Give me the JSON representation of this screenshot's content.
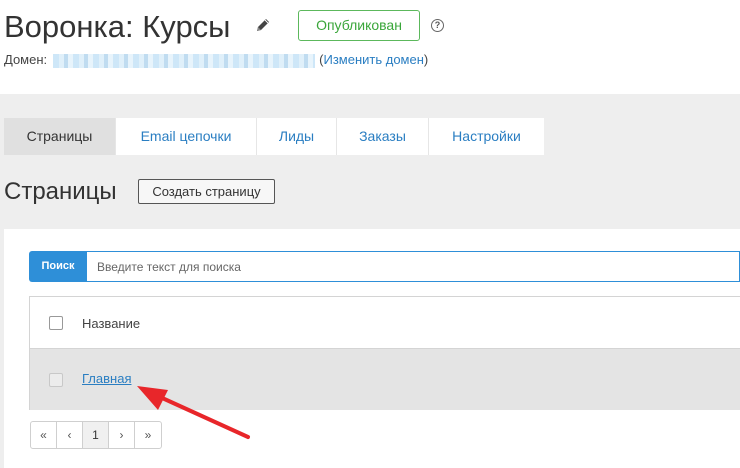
{
  "header": {
    "title": "Воронка: Курсы",
    "publish_button": "Опубликован",
    "help_icon": "?",
    "domain_label": "Домен:",
    "domain_paren_open": "(",
    "change_domain_link": "Изменить домен",
    "domain_paren_close": ")"
  },
  "tabs": [
    {
      "label": "Страницы",
      "active": true
    },
    {
      "label": "Email цепочки",
      "active": false
    },
    {
      "label": "Лиды",
      "active": false
    },
    {
      "label": "Заказы",
      "active": false
    },
    {
      "label": "Настройки",
      "active": false
    }
  ],
  "section": {
    "title": "Страницы",
    "create_button": "Создать страницу"
  },
  "search": {
    "button": "Поиск",
    "placeholder": "Введите текст для поиска"
  },
  "table": {
    "column_name": "Название",
    "rows": [
      {
        "name": "Главная"
      }
    ]
  },
  "pagination": {
    "first": "«",
    "prev": "‹",
    "current": "1",
    "next": "›",
    "last": "»"
  },
  "icons": {
    "edit": "pencil-icon",
    "help": "question-circle-icon",
    "checkbox": "checkbox-icon"
  },
  "colors": {
    "accent": "#2e8fd8",
    "link": "#2a7ec2",
    "published": "#3aa63a",
    "annotation_arrow": "#e8262a"
  }
}
